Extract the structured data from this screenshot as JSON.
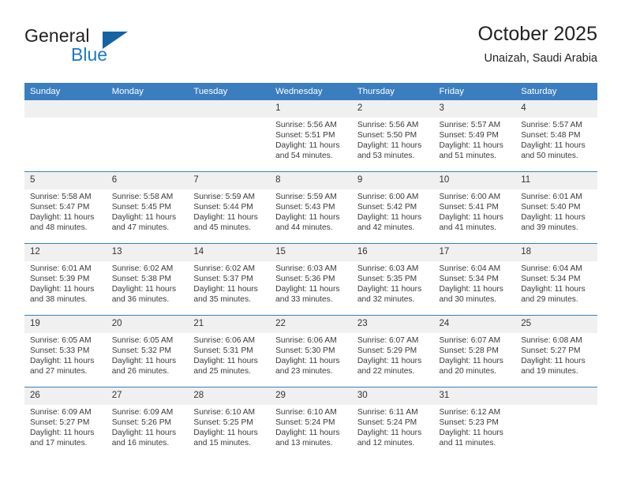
{
  "brand": {
    "word1": "General",
    "word2": "Blue",
    "logo_icon": "triangle-flag-icon",
    "accent_color": "#1464a5",
    "text_color": "#1f78c1"
  },
  "header": {
    "title": "October 2025",
    "subtitle": "Unaizah, Saudi Arabia"
  },
  "theme": {
    "header_bg": "#3b7ec0",
    "daynum_bg": "#f0f0f0",
    "separator": "#3b7ec0"
  },
  "weekday_headers": [
    "Sunday",
    "Monday",
    "Tuesday",
    "Wednesday",
    "Thursday",
    "Friday",
    "Saturday"
  ],
  "labels": {
    "sunrise": "Sunrise:",
    "sunset": "Sunset:",
    "daylight": "Daylight:"
  },
  "weeks": [
    [
      {
        "day": "",
        "sunrise": "",
        "sunset": "",
        "daylight_line1": "",
        "daylight_line2": ""
      },
      {
        "day": "",
        "sunrise": "",
        "sunset": "",
        "daylight_line1": "",
        "daylight_line2": ""
      },
      {
        "day": "",
        "sunrise": "",
        "sunset": "",
        "daylight_line1": "",
        "daylight_line2": ""
      },
      {
        "day": "1",
        "sunrise": "Sunrise: 5:56 AM",
        "sunset": "Sunset: 5:51 PM",
        "daylight_line1": "Daylight: 11 hours",
        "daylight_line2": "and 54 minutes."
      },
      {
        "day": "2",
        "sunrise": "Sunrise: 5:56 AM",
        "sunset": "Sunset: 5:50 PM",
        "daylight_line1": "Daylight: 11 hours",
        "daylight_line2": "and 53 minutes."
      },
      {
        "day": "3",
        "sunrise": "Sunrise: 5:57 AM",
        "sunset": "Sunset: 5:49 PM",
        "daylight_line1": "Daylight: 11 hours",
        "daylight_line2": "and 51 minutes."
      },
      {
        "day": "4",
        "sunrise": "Sunrise: 5:57 AM",
        "sunset": "Sunset: 5:48 PM",
        "daylight_line1": "Daylight: 11 hours",
        "daylight_line2": "and 50 minutes."
      }
    ],
    [
      {
        "day": "5",
        "sunrise": "Sunrise: 5:58 AM",
        "sunset": "Sunset: 5:47 PM",
        "daylight_line1": "Daylight: 11 hours",
        "daylight_line2": "and 48 minutes."
      },
      {
        "day": "6",
        "sunrise": "Sunrise: 5:58 AM",
        "sunset": "Sunset: 5:45 PM",
        "daylight_line1": "Daylight: 11 hours",
        "daylight_line2": "and 47 minutes."
      },
      {
        "day": "7",
        "sunrise": "Sunrise: 5:59 AM",
        "sunset": "Sunset: 5:44 PM",
        "daylight_line1": "Daylight: 11 hours",
        "daylight_line2": "and 45 minutes."
      },
      {
        "day": "8",
        "sunrise": "Sunrise: 5:59 AM",
        "sunset": "Sunset: 5:43 PM",
        "daylight_line1": "Daylight: 11 hours",
        "daylight_line2": "and 44 minutes."
      },
      {
        "day": "9",
        "sunrise": "Sunrise: 6:00 AM",
        "sunset": "Sunset: 5:42 PM",
        "daylight_line1": "Daylight: 11 hours",
        "daylight_line2": "and 42 minutes."
      },
      {
        "day": "10",
        "sunrise": "Sunrise: 6:00 AM",
        "sunset": "Sunset: 5:41 PM",
        "daylight_line1": "Daylight: 11 hours",
        "daylight_line2": "and 41 minutes."
      },
      {
        "day": "11",
        "sunrise": "Sunrise: 6:01 AM",
        "sunset": "Sunset: 5:40 PM",
        "daylight_line1": "Daylight: 11 hours",
        "daylight_line2": "and 39 minutes."
      }
    ],
    [
      {
        "day": "12",
        "sunrise": "Sunrise: 6:01 AM",
        "sunset": "Sunset: 5:39 PM",
        "daylight_line1": "Daylight: 11 hours",
        "daylight_line2": "and 38 minutes."
      },
      {
        "day": "13",
        "sunrise": "Sunrise: 6:02 AM",
        "sunset": "Sunset: 5:38 PM",
        "daylight_line1": "Daylight: 11 hours",
        "daylight_line2": "and 36 minutes."
      },
      {
        "day": "14",
        "sunrise": "Sunrise: 6:02 AM",
        "sunset": "Sunset: 5:37 PM",
        "daylight_line1": "Daylight: 11 hours",
        "daylight_line2": "and 35 minutes."
      },
      {
        "day": "15",
        "sunrise": "Sunrise: 6:03 AM",
        "sunset": "Sunset: 5:36 PM",
        "daylight_line1": "Daylight: 11 hours",
        "daylight_line2": "and 33 minutes."
      },
      {
        "day": "16",
        "sunrise": "Sunrise: 6:03 AM",
        "sunset": "Sunset: 5:35 PM",
        "daylight_line1": "Daylight: 11 hours",
        "daylight_line2": "and 32 minutes."
      },
      {
        "day": "17",
        "sunrise": "Sunrise: 6:04 AM",
        "sunset": "Sunset: 5:34 PM",
        "daylight_line1": "Daylight: 11 hours",
        "daylight_line2": "and 30 minutes."
      },
      {
        "day": "18",
        "sunrise": "Sunrise: 6:04 AM",
        "sunset": "Sunset: 5:34 PM",
        "daylight_line1": "Daylight: 11 hours",
        "daylight_line2": "and 29 minutes."
      }
    ],
    [
      {
        "day": "19",
        "sunrise": "Sunrise: 6:05 AM",
        "sunset": "Sunset: 5:33 PM",
        "daylight_line1": "Daylight: 11 hours",
        "daylight_line2": "and 27 minutes."
      },
      {
        "day": "20",
        "sunrise": "Sunrise: 6:05 AM",
        "sunset": "Sunset: 5:32 PM",
        "daylight_line1": "Daylight: 11 hours",
        "daylight_line2": "and 26 minutes."
      },
      {
        "day": "21",
        "sunrise": "Sunrise: 6:06 AM",
        "sunset": "Sunset: 5:31 PM",
        "daylight_line1": "Daylight: 11 hours",
        "daylight_line2": "and 25 minutes."
      },
      {
        "day": "22",
        "sunrise": "Sunrise: 6:06 AM",
        "sunset": "Sunset: 5:30 PM",
        "daylight_line1": "Daylight: 11 hours",
        "daylight_line2": "and 23 minutes."
      },
      {
        "day": "23",
        "sunrise": "Sunrise: 6:07 AM",
        "sunset": "Sunset: 5:29 PM",
        "daylight_line1": "Daylight: 11 hours",
        "daylight_line2": "and 22 minutes."
      },
      {
        "day": "24",
        "sunrise": "Sunrise: 6:07 AM",
        "sunset": "Sunset: 5:28 PM",
        "daylight_line1": "Daylight: 11 hours",
        "daylight_line2": "and 20 minutes."
      },
      {
        "day": "25",
        "sunrise": "Sunrise: 6:08 AM",
        "sunset": "Sunset: 5:27 PM",
        "daylight_line1": "Daylight: 11 hours",
        "daylight_line2": "and 19 minutes."
      }
    ],
    [
      {
        "day": "26",
        "sunrise": "Sunrise: 6:09 AM",
        "sunset": "Sunset: 5:27 PM",
        "daylight_line1": "Daylight: 11 hours",
        "daylight_line2": "and 17 minutes."
      },
      {
        "day": "27",
        "sunrise": "Sunrise: 6:09 AM",
        "sunset": "Sunset: 5:26 PM",
        "daylight_line1": "Daylight: 11 hours",
        "daylight_line2": "and 16 minutes."
      },
      {
        "day": "28",
        "sunrise": "Sunrise: 6:10 AM",
        "sunset": "Sunset: 5:25 PM",
        "daylight_line1": "Daylight: 11 hours",
        "daylight_line2": "and 15 minutes."
      },
      {
        "day": "29",
        "sunrise": "Sunrise: 6:10 AM",
        "sunset": "Sunset: 5:24 PM",
        "daylight_line1": "Daylight: 11 hours",
        "daylight_line2": "and 13 minutes."
      },
      {
        "day": "30",
        "sunrise": "Sunrise: 6:11 AM",
        "sunset": "Sunset: 5:24 PM",
        "daylight_line1": "Daylight: 11 hours",
        "daylight_line2": "and 12 minutes."
      },
      {
        "day": "31",
        "sunrise": "Sunrise: 6:12 AM",
        "sunset": "Sunset: 5:23 PM",
        "daylight_line1": "Daylight: 11 hours",
        "daylight_line2": "and 11 minutes."
      },
      {
        "day": "",
        "sunrise": "",
        "sunset": "",
        "daylight_line1": "",
        "daylight_line2": ""
      }
    ]
  ]
}
